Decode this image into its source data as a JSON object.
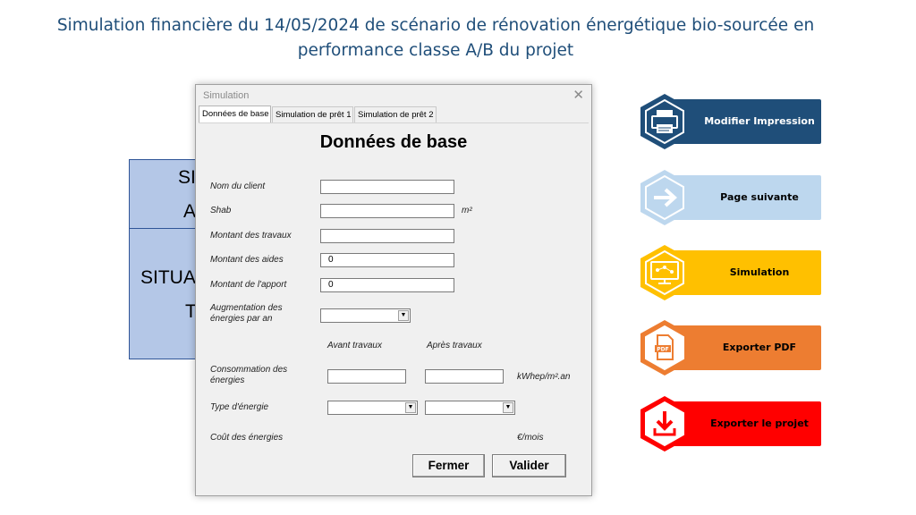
{
  "page": {
    "title_line1": "Simulation financière du 14/05/2024 de scénario de rénovation énergétique bio-sourcée en",
    "title_line2": "performance classe A/B du projet"
  },
  "background_table": {
    "row1_top": "SI",
    "row1_bottom": "A",
    "row2_top": "SITUA",
    "row2_bottom": "T"
  },
  "dialog": {
    "title": "Simulation",
    "close": "✕",
    "tabs": [
      "Données de base",
      "Simulation de prêt 1",
      "Simulation de prêt 2"
    ],
    "active_tab": 0,
    "heading": "Données de base",
    "fields": {
      "client_label": "Nom du client",
      "client_value": "",
      "shab_label": "Shab",
      "shab_value": "",
      "shab_unit": "m²",
      "travaux_label": "Montant des travaux",
      "travaux_value": "",
      "aides_label": "Montant des aides",
      "aides_value": "0",
      "apport_label": "Montant de l'apport",
      "apport_value": "0",
      "augmentation_label_1": "Augmentation des",
      "augmentation_label_2": "énergies par an",
      "augmentation_value": "",
      "avant_header": "Avant travaux",
      "apres_header": "Après travaux",
      "conso_label_1": "Consommation des",
      "conso_label_2": "énergies",
      "conso_avant_value": "",
      "conso_apres_value": "",
      "conso_unit": "kWhep/m².an",
      "type_label": "Type d'énergie",
      "type_avant_value": "",
      "type_apres_value": "",
      "cout_label": "Coût des énergies",
      "cout_unit": "€/mois"
    },
    "buttons": {
      "fermer": "Fermer",
      "valider": "Valider"
    },
    "dropdown_arrow": "▼"
  },
  "actions": [
    {
      "label": "Modifier Impression",
      "icon": "printer-icon",
      "bar_color": "#1f4e79",
      "hex_color": "#1f4e79",
      "text_color": "#ffffff"
    },
    {
      "label": "Page suivante",
      "icon": "arrow-right-icon",
      "bar_color": "#bdd7ee",
      "hex_color": "#bdd7ee",
      "text_color": "#000000"
    },
    {
      "label": "Simulation",
      "icon": "network-monitor-icon",
      "bar_color": "#ffc000",
      "hex_color": "#ffc000",
      "text_color": "#000000"
    },
    {
      "label": "Exporter PDF",
      "icon": "pdf-file-icon",
      "bar_color": "#ed7d31",
      "hex_color": "#ed7d31",
      "text_color": "#000000"
    },
    {
      "label": "Exporter le projet",
      "icon": "download-icon",
      "bar_color": "#ff0000",
      "hex_color": "#ff0000",
      "text_color": "#000000"
    }
  ]
}
